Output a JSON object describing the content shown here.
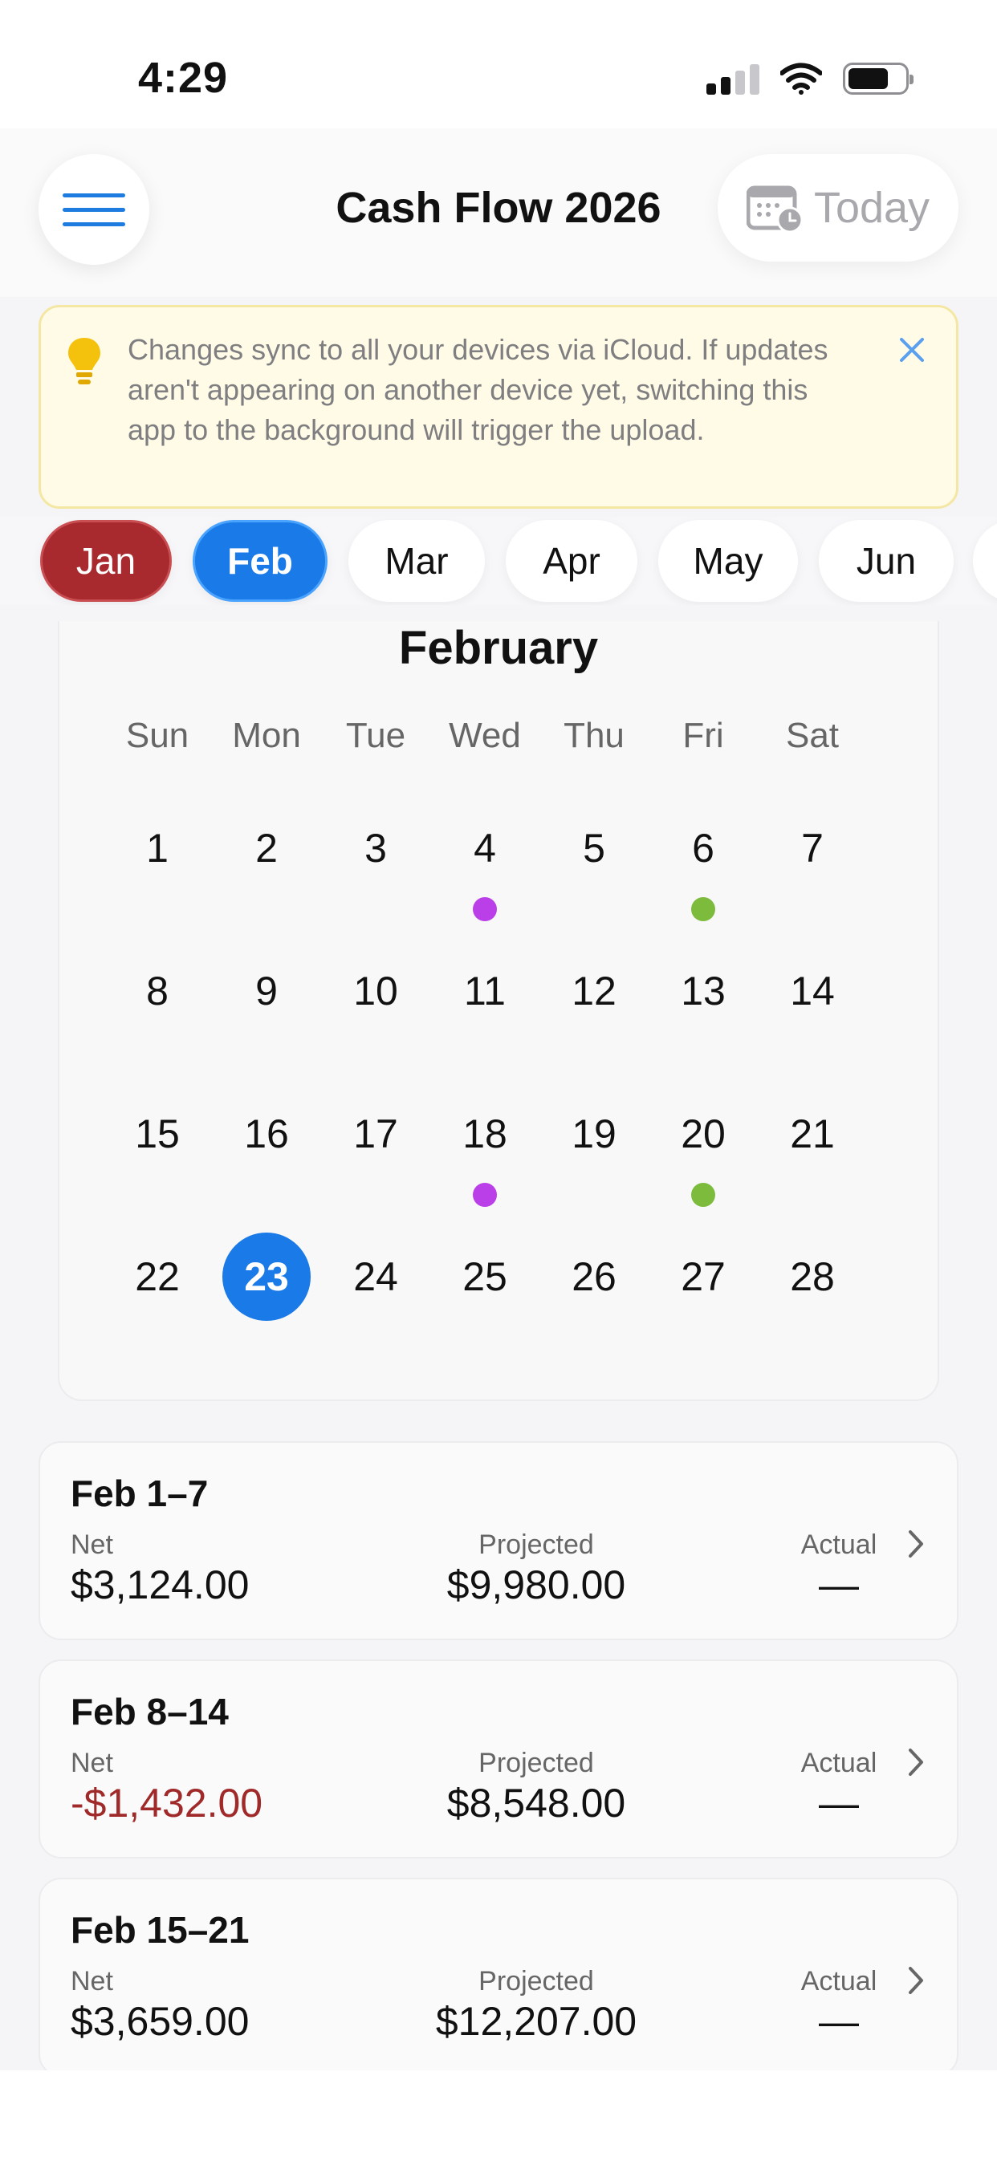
{
  "status": {
    "time": "4:29"
  },
  "header": {
    "title": "Cash Flow 2026",
    "today_label": "Today",
    "menu_icon": "hamburger-menu-icon",
    "calendar_icon": "calendar-clock-icon"
  },
  "banner": {
    "text": "Changes sync to all your devices via iCloud. If updates aren't appearing on another device yet, switching this app to the background will trigger the upload.",
    "icon": "lightbulb-icon",
    "close_icon": "close-icon"
  },
  "months": [
    {
      "label": "Jan",
      "state": "past"
    },
    {
      "label": "Feb",
      "state": "active"
    },
    {
      "label": "Mar",
      "state": "future"
    },
    {
      "label": "Apr",
      "state": "future"
    },
    {
      "label": "May",
      "state": "future"
    },
    {
      "label": "Jun",
      "state": "future"
    }
  ],
  "calendar": {
    "month_title": "February",
    "weekdays": [
      "Sun",
      "Mon",
      "Tue",
      "Wed",
      "Thu",
      "Fri",
      "Sat"
    ],
    "weeks": [
      [
        "1",
        "2",
        "3",
        "4",
        "5",
        "6",
        "7"
      ],
      [
        "8",
        "9",
        "10",
        "11",
        "12",
        "13",
        "14"
      ],
      [
        "15",
        "16",
        "17",
        "18",
        "19",
        "20",
        "21"
      ],
      [
        "22",
        "23",
        "24",
        "25",
        "26",
        "27",
        "28"
      ]
    ],
    "today": "23",
    "events": [
      {
        "day": "4",
        "color": "#bb3fe8"
      },
      {
        "day": "6",
        "color": "#7dbb3c"
      },
      {
        "day": "18",
        "color": "#bb3fe8"
      },
      {
        "day": "20",
        "color": "#7dbb3c"
      }
    ],
    "accent": "#1a7ae8"
  },
  "weeks": [
    {
      "title": "Feb 1–7",
      "net_label": "Net",
      "net": "$3,124.00",
      "negative": false,
      "projected_label": "Projected",
      "projected": "$9,980.00",
      "actual_label": "Actual",
      "actual": "—"
    },
    {
      "title": "Feb 8–14",
      "net_label": "Net",
      "net": "-$1,432.00",
      "negative": true,
      "projected_label": "Projected",
      "projected": "$8,548.00",
      "actual_label": "Actual",
      "actual": "—"
    },
    {
      "title": "Feb 15–21",
      "net_label": "Net",
      "net": "$3,659.00",
      "negative": false,
      "projected_label": "Projected",
      "projected": "$12,207.00",
      "actual_label": "Actual",
      "actual": "—"
    }
  ]
}
